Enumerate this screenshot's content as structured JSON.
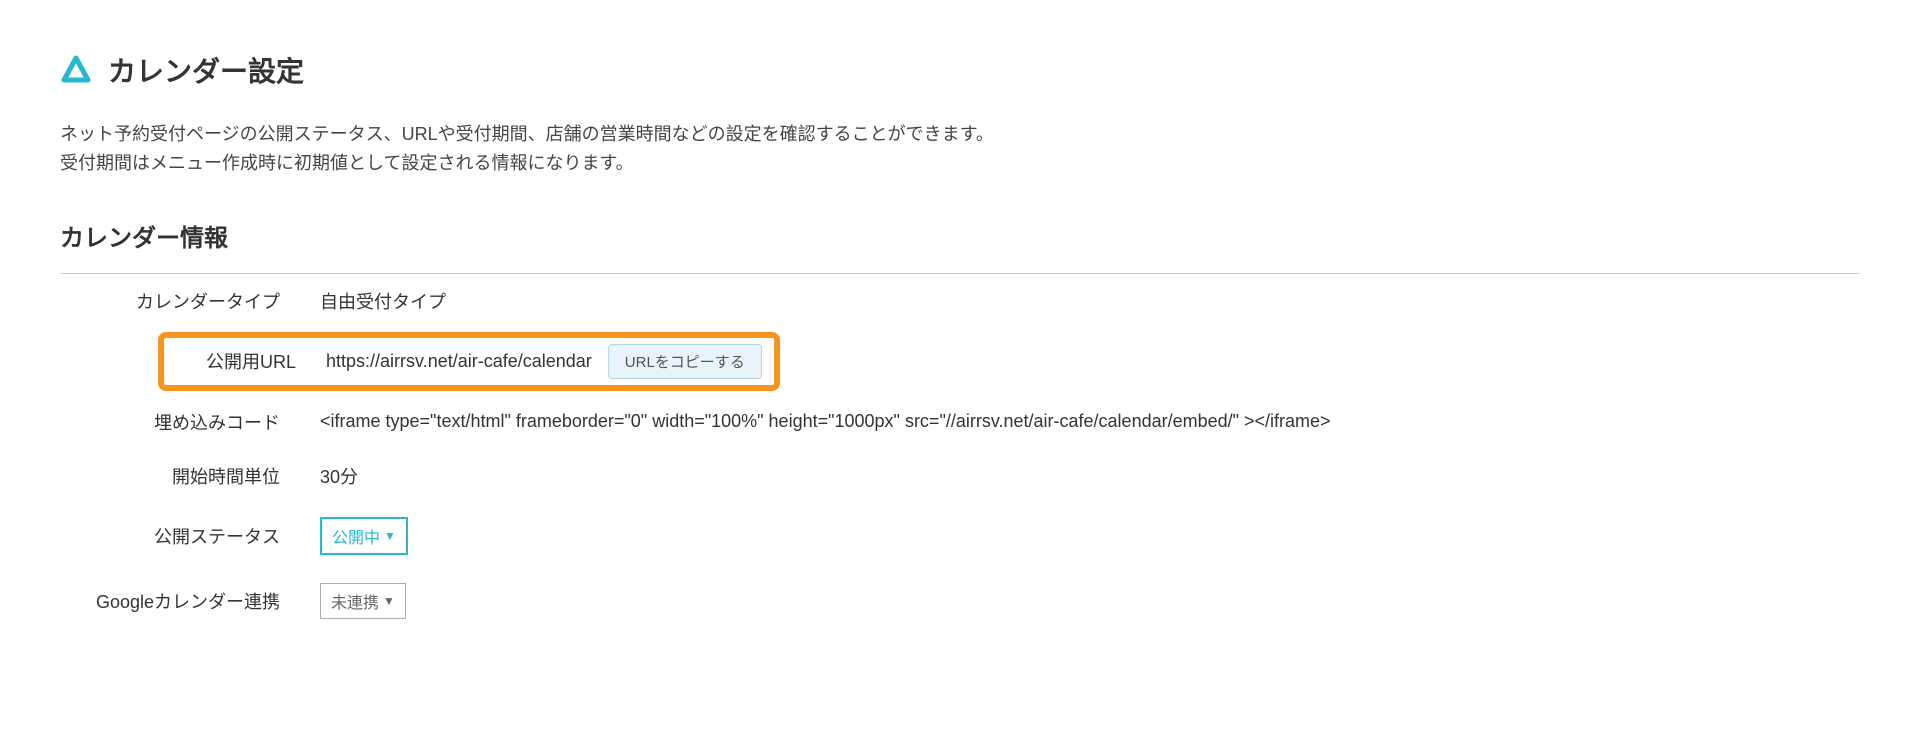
{
  "header": {
    "title": "カレンダー設定"
  },
  "description": {
    "line1": "ネット予約受付ページの公開ステータス、URLや受付期間、店舗の営業時間などの設定を確認することができます。",
    "line2": "受付期間はメニュー作成時に初期値として設定される情報になります。"
  },
  "section": {
    "title": "カレンダー情報"
  },
  "fields": {
    "calendar_type": {
      "label": "カレンダータイプ",
      "value": "自由受付タイプ"
    },
    "public_url": {
      "label": "公開用URL",
      "value": "https://airrsv.net/air-cafe/calendar",
      "copy_button": "URLをコピーする"
    },
    "embed_code": {
      "label": "埋め込みコード",
      "value": "<iframe type=\"text/html\" frameborder=\"0\" width=\"100%\" height=\"1000px\" src=\"//airrsv.net/air-cafe/calendar/embed/\" ></iframe>"
    },
    "start_time_unit": {
      "label": "開始時間単位",
      "value": "30分"
    },
    "public_status": {
      "label": "公開ステータス",
      "value": "公開中"
    },
    "google_calendar": {
      "label": "Googleカレンダー連携",
      "value": "未連携"
    }
  }
}
